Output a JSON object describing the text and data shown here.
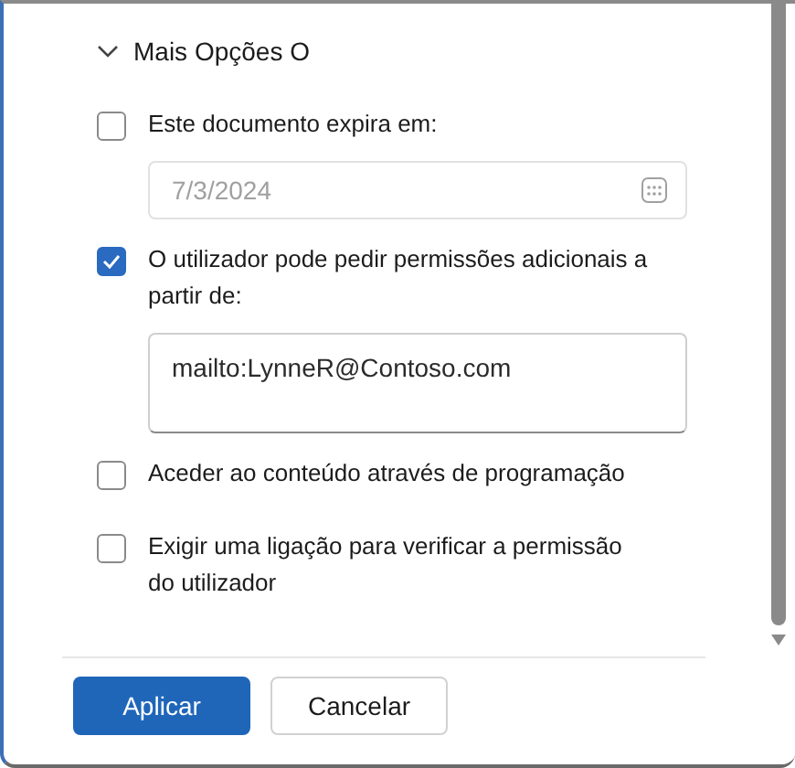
{
  "section": {
    "title": "Mais Opções O",
    "expanded": true
  },
  "options": [
    {
      "label": "Este documento expira em:",
      "checked": false,
      "field": {
        "kind": "date",
        "value": "7/3/2024",
        "disabled": true
      }
    },
    {
      "label": "O utilizador pode pedir permissões adicionais a partir de:",
      "checked": true,
      "field": {
        "kind": "text",
        "value": "mailto:LynneR@Contoso.com",
        "disabled": false
      }
    },
    {
      "label": "Aceder ao conteúdo através de programação",
      "checked": false
    },
    {
      "label": "Exigir uma ligação para verificar a permissão do utilizador",
      "checked": false
    }
  ],
  "buttons": [
    {
      "label": "Aplicar",
      "primary": true
    },
    {
      "label": "Cancelar",
      "primary": false
    }
  ]
}
